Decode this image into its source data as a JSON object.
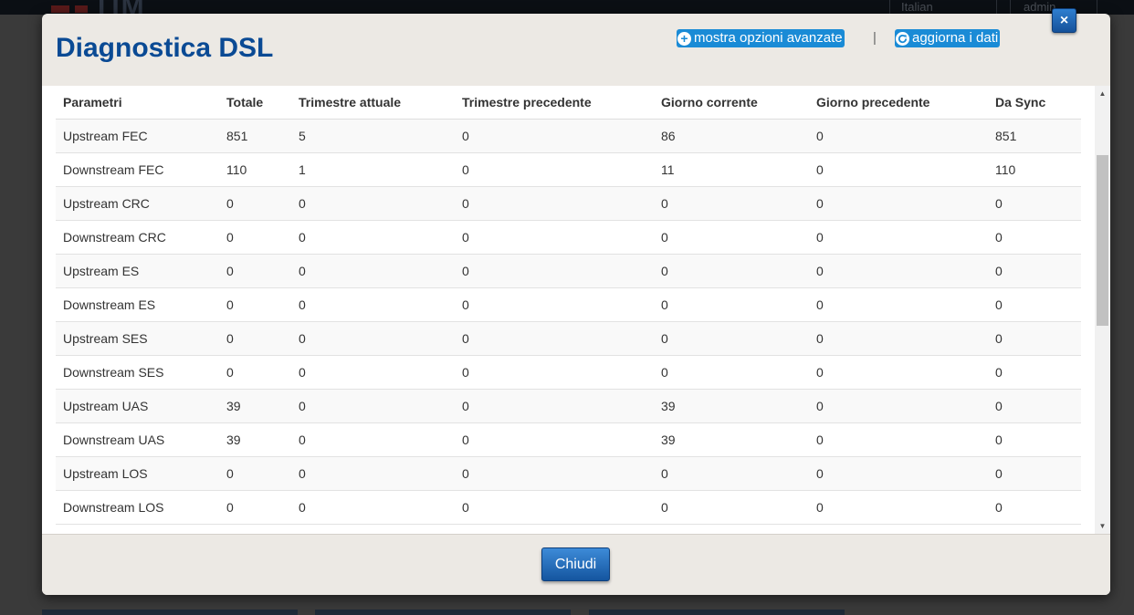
{
  "background": {
    "logo_text": "TIM",
    "language_value": "Italian",
    "user_value": "admin"
  },
  "modal": {
    "title": "Diagnostica DSL",
    "advanced_link": "mostra opzioni avanzate",
    "separator": "|",
    "refresh_link": "aggiorna i dati",
    "close_label": "×",
    "footer_button": "Chiudi"
  },
  "table": {
    "headers": [
      "Parametri",
      "Totale",
      "Trimestre attuale",
      "Trimestre precedente",
      "Giorno corrente",
      "Giorno precedente",
      "Da Sync"
    ],
    "rows": [
      [
        "Upstream FEC",
        "851",
        "5",
        "0",
        "86",
        "0",
        "851"
      ],
      [
        "Downstream FEC",
        "110",
        "1",
        "0",
        "11",
        "0",
        "110"
      ],
      [
        "Upstream CRC",
        "0",
        "0",
        "0",
        "0",
        "0",
        "0"
      ],
      [
        "Downstream CRC",
        "0",
        "0",
        "0",
        "0",
        "0",
        "0"
      ],
      [
        "Upstream ES",
        "0",
        "0",
        "0",
        "0",
        "0",
        "0"
      ],
      [
        "Downstream ES",
        "0",
        "0",
        "0",
        "0",
        "0",
        "0"
      ],
      [
        "Upstream SES",
        "0",
        "0",
        "0",
        "0",
        "0",
        "0"
      ],
      [
        "Downstream SES",
        "0",
        "0",
        "0",
        "0",
        "0",
        "0"
      ],
      [
        "Upstream UAS",
        "39",
        "0",
        "0",
        "39",
        "0",
        "0"
      ],
      [
        "Downstream UAS",
        "39",
        "0",
        "0",
        "39",
        "0",
        "0"
      ],
      [
        "Upstream LOS",
        "0",
        "0",
        "0",
        "0",
        "0",
        "0"
      ],
      [
        "Downstream LOS",
        "0",
        "0",
        "0",
        "0",
        "0",
        "0"
      ]
    ]
  },
  "icons": {
    "advanced": "plus-circle-icon",
    "refresh": "refresh-icon"
  },
  "colors": {
    "title": "#0a4a94",
    "link_bg": "#1a8bd6",
    "button": "#1b5fa8"
  }
}
